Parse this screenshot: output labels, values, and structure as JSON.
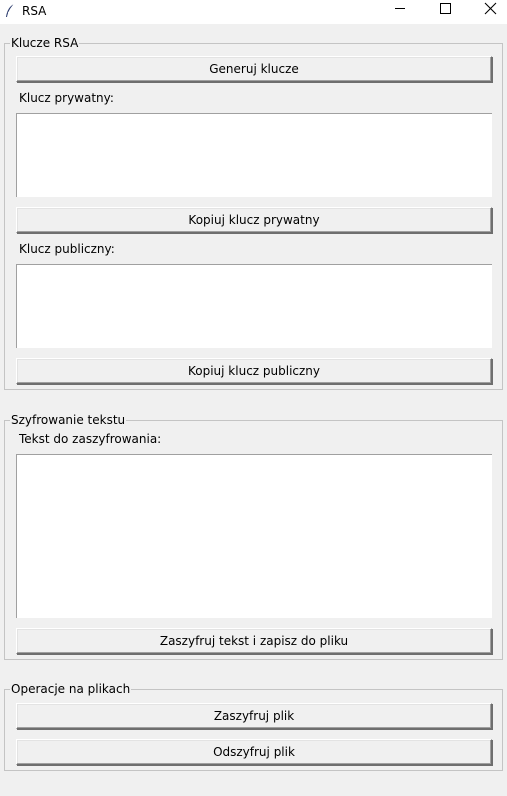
{
  "window": {
    "title": "RSA",
    "app_icon": "feather-icon",
    "controls": [
      "minimize-icon",
      "maximize-icon",
      "close-icon"
    ]
  },
  "keys_section": {
    "title": "Klucze RSA",
    "generate_button": "Generuj klucze",
    "private_key_label": "Klucz prywatny:",
    "private_key_value": "",
    "copy_private_button": "Kopiuj klucz prywatny",
    "public_key_label": "Klucz publiczny:",
    "public_key_value": "",
    "copy_public_button": "Kopiuj klucz publiczny"
  },
  "encrypt_text_section": {
    "title": "Szyfrowanie tekstu",
    "text_label": "Tekst do zaszyfrowania:",
    "text_value": "",
    "encrypt_save_button": "Zaszyfruj tekst i zapisz do pliku"
  },
  "file_ops_section": {
    "title": "Operacje na plikach",
    "encrypt_file_button": "Zaszyfruj plik",
    "decrypt_file_button": "Odszyfruj plik"
  }
}
